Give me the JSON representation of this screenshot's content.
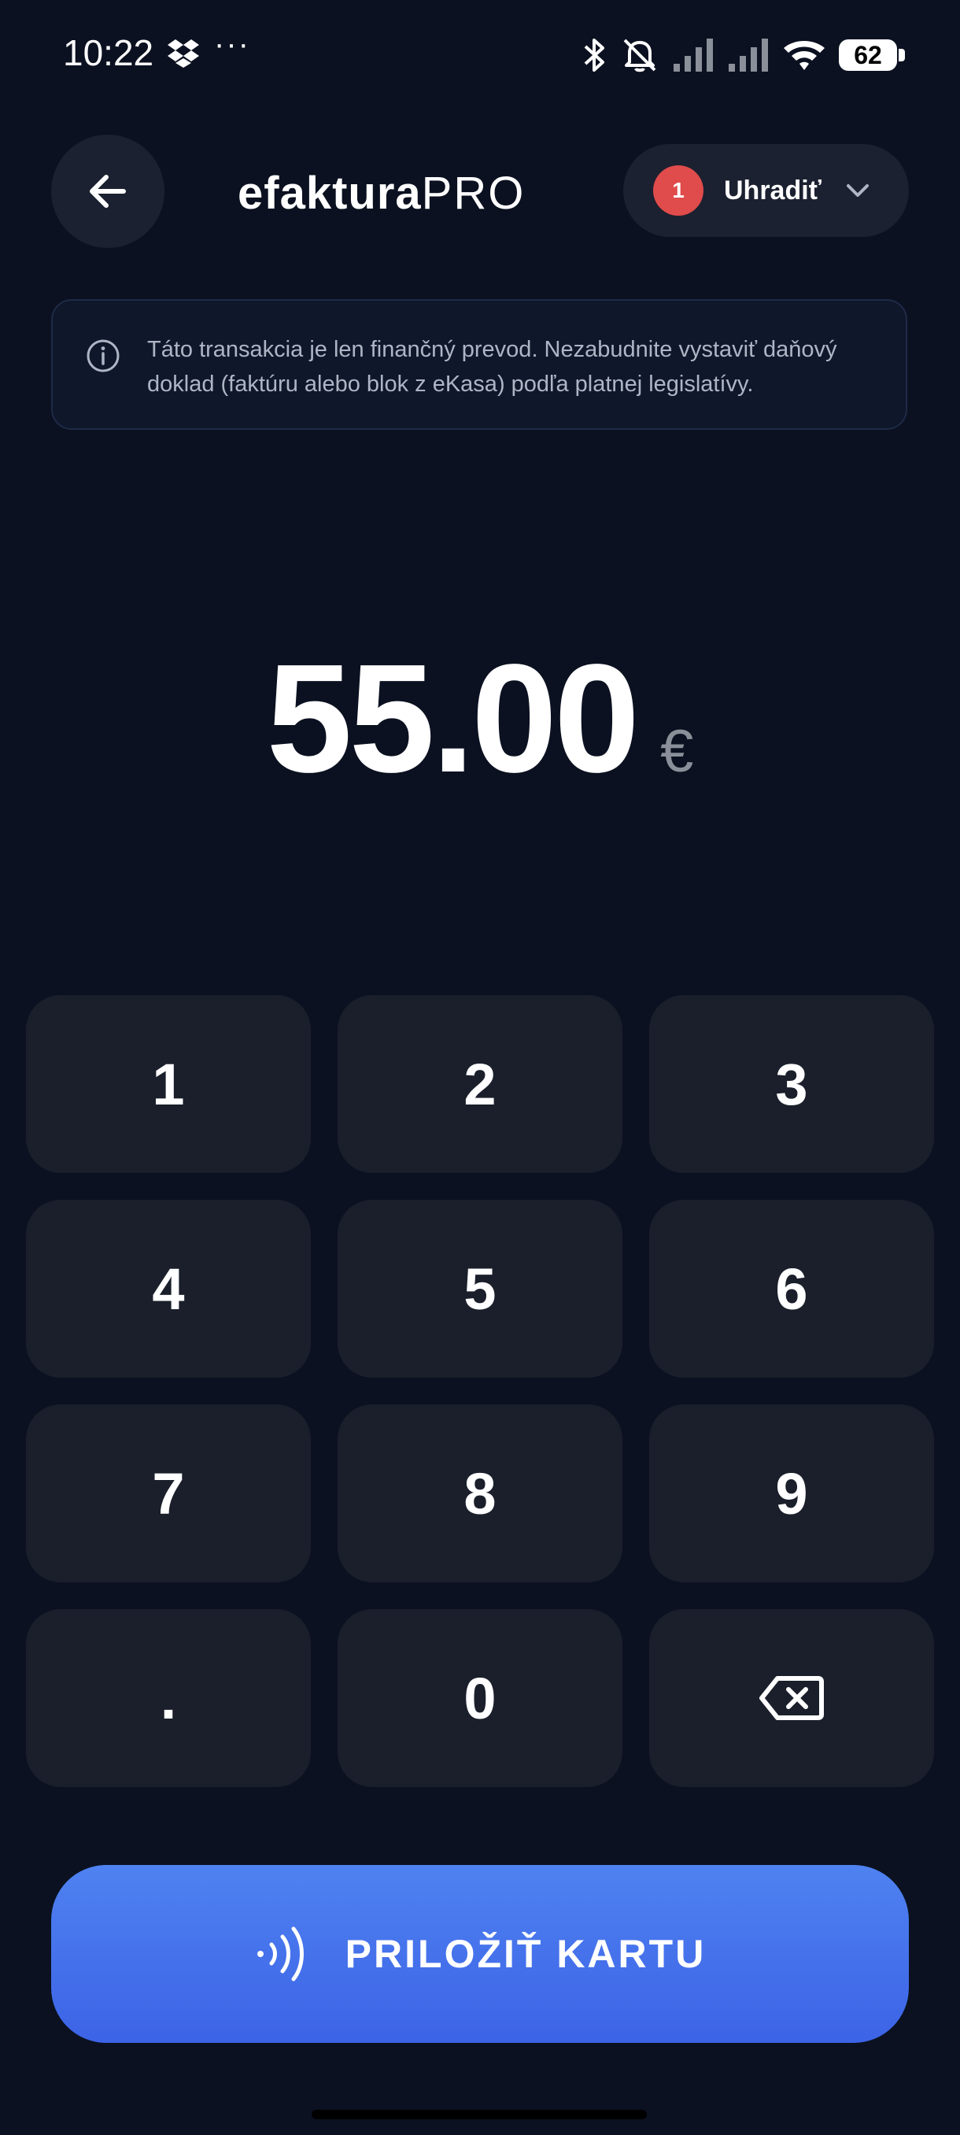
{
  "status_bar": {
    "time": "10:22",
    "dots": "···",
    "battery": "62",
    "icons": [
      "dropbox-icon",
      "bluetooth-icon",
      "bell-off-icon",
      "signal-icon",
      "signal-icon",
      "wifi-icon",
      "battery-icon"
    ]
  },
  "header": {
    "back_icon": "arrow-left-icon",
    "logo_main": "efaktura",
    "logo_pro": "PRO",
    "payment": {
      "badge": "1",
      "label": "Uhradiť",
      "chevron_icon": "chevron-down-icon"
    }
  },
  "info": {
    "icon": "info-icon",
    "text": "Táto transakcia je len finančný prevod. Nezabudnite vystaviť daňový doklad (faktúru alebo blok z eKasa) podľa platnej legislatívy."
  },
  "amount": {
    "value": "55.00",
    "currency": "€"
  },
  "keypad": {
    "keys": [
      "1",
      "2",
      "3",
      "4",
      "5",
      "6",
      "7",
      "8",
      "9",
      ".",
      "0"
    ],
    "backspace_icon": "backspace-icon"
  },
  "primary_button": {
    "icon": "nfc-icon",
    "label": "PRILOŽIŤ KARTU"
  },
  "colors": {
    "background": "#0b1120",
    "key_background": "#1a1f2b",
    "accent_blue": "#3c63e6",
    "badge_red": "#e04b4b"
  }
}
